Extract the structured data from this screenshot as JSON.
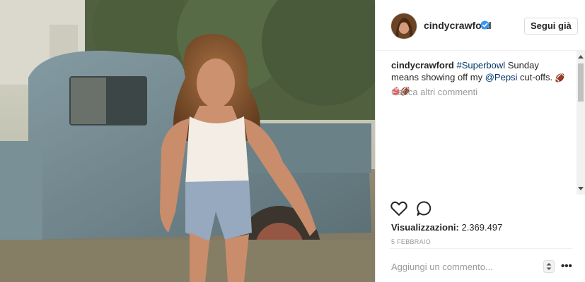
{
  "post": {
    "media": {
      "description_icon": "photo"
    },
    "header": {
      "username": "cindycrawford",
      "follow_label": "Segui già",
      "verified_icon": "verified-badge-icon"
    },
    "caption": {
      "author": "cindycrawford",
      "hashtag": "#Superbowl",
      "text_1": " Sunday means showing off my ",
      "mention": "@Pepsi",
      "text_2": " cut-offs. ",
      "emoji": "🏈👙🏈"
    },
    "load_more_label": "Carica altri commenti",
    "actions": {
      "like_icon": "heart-icon",
      "comment_icon": "comment-icon"
    },
    "views_label": "Visualizzazioni:",
    "views_count": "2.369.497",
    "date": "5 FEBBRAIO",
    "comment_placeholder": "Aggiungi un commento...",
    "more_label": "•••"
  },
  "colors": {
    "link": "#003569",
    "muted": "#999999",
    "text": "#262626",
    "verified": "#3897f0"
  }
}
